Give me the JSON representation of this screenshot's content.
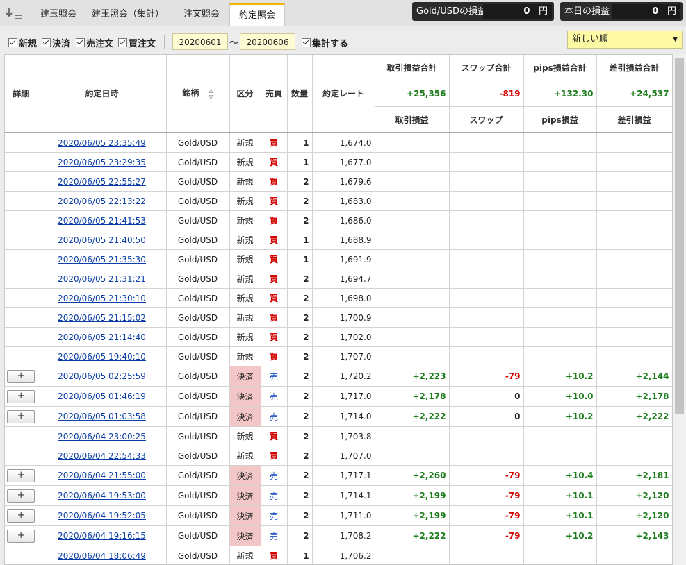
{
  "tabs": [
    "建玉照会",
    "建玉照会（集計）",
    "注文照会",
    "約定照会"
  ],
  "pnl": {
    "symbol_label": "Gold/USDの損益",
    "symbol_value": "0",
    "today_label": "本日の損益",
    "today_value": "0",
    "unit": "円"
  },
  "filters": {
    "new": "新規",
    "settle": "決済",
    "sell_order": "売注文",
    "buy_order": "買注文",
    "date_from": "20200601",
    "tilde": "〜",
    "date_to": "20200606",
    "aggregate": "集計する",
    "sort_selected": "新しい順"
  },
  "columns": {
    "detail": "詳細",
    "datetime": "約定日時",
    "symbol": "銘柄",
    "category": "区分",
    "side": "売買",
    "qty": "数量",
    "rate": "約定レート",
    "pl_total": "取引損益合計",
    "swap_total": "スワップ合計",
    "pips_total": "pips損益合計",
    "net_total": "差引損益合計",
    "pl": "取引損益",
    "swap": "スワップ",
    "pips": "pips損益",
    "net": "差引損益"
  },
  "totals": {
    "pl": "+25,356",
    "swap": "-819",
    "pips": "+132.30",
    "net": "+24,537"
  },
  "rows": [
    {
      "detail": "",
      "datetime": "2020/06/05 23:35:49",
      "symbol": "Gold/USD",
      "category": "新規",
      "side": "買",
      "qty": "1",
      "rate": "1,674.0",
      "pl": "",
      "swap": "",
      "pips": "",
      "net": ""
    },
    {
      "detail": "",
      "datetime": "2020/06/05 23:29:35",
      "symbol": "Gold/USD",
      "category": "新規",
      "side": "買",
      "qty": "1",
      "rate": "1,677.0",
      "pl": "",
      "swap": "",
      "pips": "",
      "net": ""
    },
    {
      "detail": "",
      "datetime": "2020/06/05 22:55:27",
      "symbol": "Gold/USD",
      "category": "新規",
      "side": "買",
      "qty": "2",
      "rate": "1,679.6",
      "pl": "",
      "swap": "",
      "pips": "",
      "net": ""
    },
    {
      "detail": "",
      "datetime": "2020/06/05 22:13:22",
      "symbol": "Gold/USD",
      "category": "新規",
      "side": "買",
      "qty": "2",
      "rate": "1,683.0",
      "pl": "",
      "swap": "",
      "pips": "",
      "net": ""
    },
    {
      "detail": "",
      "datetime": "2020/06/05 21:41:53",
      "symbol": "Gold/USD",
      "category": "新規",
      "side": "買",
      "qty": "2",
      "rate": "1,686.0",
      "pl": "",
      "swap": "",
      "pips": "",
      "net": ""
    },
    {
      "detail": "",
      "datetime": "2020/06/05 21:40:50",
      "symbol": "Gold/USD",
      "category": "新規",
      "side": "買",
      "qty": "1",
      "rate": "1,688.9",
      "pl": "",
      "swap": "",
      "pips": "",
      "net": ""
    },
    {
      "detail": "",
      "datetime": "2020/06/05 21:35:30",
      "symbol": "Gold/USD",
      "category": "新規",
      "side": "買",
      "qty": "1",
      "rate": "1,691.9",
      "pl": "",
      "swap": "",
      "pips": "",
      "net": ""
    },
    {
      "detail": "",
      "datetime": "2020/06/05 21:31:21",
      "symbol": "Gold/USD",
      "category": "新規",
      "side": "買",
      "qty": "2",
      "rate": "1,694.7",
      "pl": "",
      "swap": "",
      "pips": "",
      "net": ""
    },
    {
      "detail": "",
      "datetime": "2020/06/05 21:30:10",
      "symbol": "Gold/USD",
      "category": "新規",
      "side": "買",
      "qty": "2",
      "rate": "1,698.0",
      "pl": "",
      "swap": "",
      "pips": "",
      "net": ""
    },
    {
      "detail": "",
      "datetime": "2020/06/05 21:15:02",
      "symbol": "Gold/USD",
      "category": "新規",
      "side": "買",
      "qty": "2",
      "rate": "1,700.9",
      "pl": "",
      "swap": "",
      "pips": "",
      "net": ""
    },
    {
      "detail": "",
      "datetime": "2020/06/05 21:14:40",
      "symbol": "Gold/USD",
      "category": "新規",
      "side": "買",
      "qty": "2",
      "rate": "1,702.0",
      "pl": "",
      "swap": "",
      "pips": "",
      "net": ""
    },
    {
      "detail": "",
      "datetime": "2020/06/05 19:40:10",
      "symbol": "Gold/USD",
      "category": "新規",
      "side": "買",
      "qty": "2",
      "rate": "1,707.0",
      "pl": "",
      "swap": "",
      "pips": "",
      "net": ""
    },
    {
      "detail": "+",
      "datetime": "2020/06/05 02:25:59",
      "symbol": "Gold/USD",
      "category": "決済",
      "side": "売",
      "qty": "2",
      "rate": "1,720.2",
      "pl": "+2,223",
      "swap": "-79",
      "pips": "+10.2",
      "net": "+2,144"
    },
    {
      "detail": "+",
      "datetime": "2020/06/05 01:46:19",
      "symbol": "Gold/USD",
      "category": "決済",
      "side": "売",
      "qty": "2",
      "rate": "1,717.0",
      "pl": "+2,178",
      "swap": "0",
      "pips": "+10.0",
      "net": "+2,178"
    },
    {
      "detail": "+",
      "datetime": "2020/06/05 01:03:58",
      "symbol": "Gold/USD",
      "category": "決済",
      "side": "売",
      "qty": "2",
      "rate": "1,714.0",
      "pl": "+2,222",
      "swap": "0",
      "pips": "+10.2",
      "net": "+2,222"
    },
    {
      "detail": "",
      "datetime": "2020/06/04 23:00:25",
      "symbol": "Gold/USD",
      "category": "新規",
      "side": "買",
      "qty": "2",
      "rate": "1,703.8",
      "pl": "",
      "swap": "",
      "pips": "",
      "net": ""
    },
    {
      "detail": "",
      "datetime": "2020/06/04 22:54:33",
      "symbol": "Gold/USD",
      "category": "新規",
      "side": "買",
      "qty": "2",
      "rate": "1,707.0",
      "pl": "",
      "swap": "",
      "pips": "",
      "net": ""
    },
    {
      "detail": "+",
      "datetime": "2020/06/04 21:55:00",
      "symbol": "Gold/USD",
      "category": "決済",
      "side": "売",
      "qty": "2",
      "rate": "1,717.1",
      "pl": "+2,260",
      "swap": "-79",
      "pips": "+10.4",
      "net": "+2,181"
    },
    {
      "detail": "+",
      "datetime": "2020/06/04 19:53:00",
      "symbol": "Gold/USD",
      "category": "決済",
      "side": "売",
      "qty": "2",
      "rate": "1,714.1",
      "pl": "+2,199",
      "swap": "-79",
      "pips": "+10.1",
      "net": "+2,120"
    },
    {
      "detail": "+",
      "datetime": "2020/06/04 19:52:05",
      "symbol": "Gold/USD",
      "category": "決済",
      "side": "売",
      "qty": "2",
      "rate": "1,711.0",
      "pl": "+2,199",
      "swap": "-79",
      "pips": "+10.1",
      "net": "+2,120"
    },
    {
      "detail": "+",
      "datetime": "2020/06/04 19:16:15",
      "symbol": "Gold/USD",
      "category": "決済",
      "side": "売",
      "qty": "2",
      "rate": "1,708.2",
      "pl": "+2,222",
      "swap": "-79",
      "pips": "+10.2",
      "net": "+2,143"
    },
    {
      "detail": "",
      "datetime": "2020/06/04 18:06:49",
      "symbol": "Gold/USD",
      "category": "新規",
      "side": "買",
      "qty": "1",
      "rate": "1,706.2",
      "pl": "",
      "swap": "",
      "pips": "",
      "net": ""
    }
  ],
  "colors": {
    "accent_tab": "#f0b400",
    "buy": "#d40000",
    "sell": "#1d4fc6",
    "positive": "#1d7d1d",
    "negative": "#d40000",
    "settle_bg": "#f3c7c7",
    "date_input_bg": "#fdfbd2",
    "select_bg": "#fdf9a5"
  },
  "icons": {
    "sort_toggle": "sort-down-icon",
    "sort_column": "sort-arrows-icon",
    "dropdown": "chevron-down-icon",
    "checkbox": "checkmark-icon"
  }
}
